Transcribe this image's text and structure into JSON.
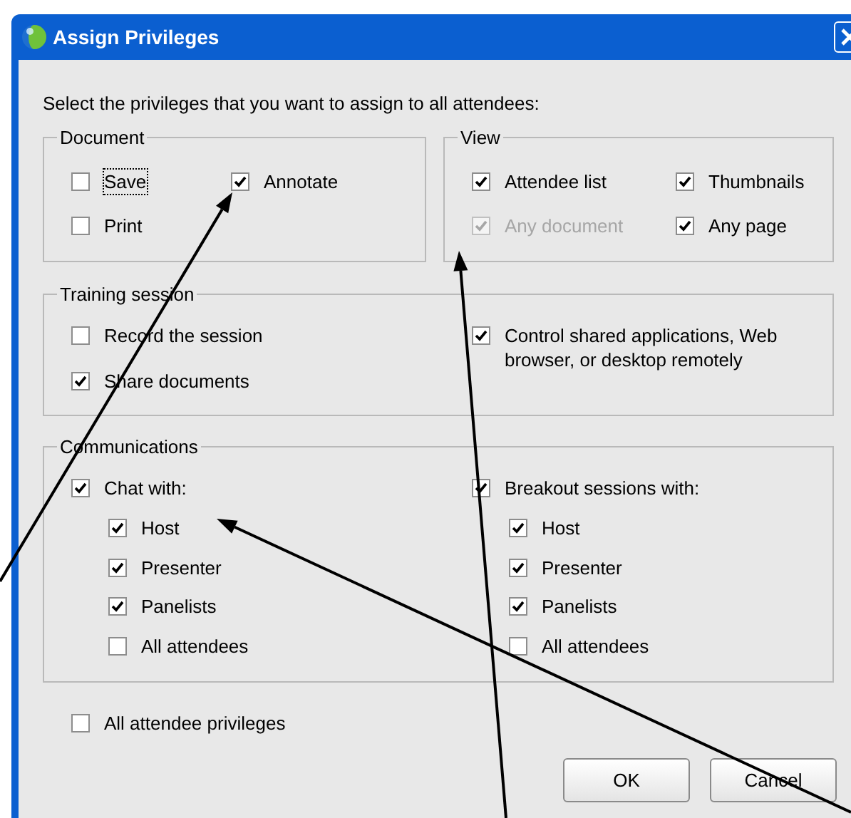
{
  "window": {
    "title": "Assign Privileges"
  },
  "instruction": "Select the privileges that you want to assign to all attendees:",
  "groups": [
    {
      "title": "Document",
      "items": [
        {
          "label": "Save",
          "checked": false,
          "disabled": false,
          "focused": true
        },
        {
          "label": "Annotate",
          "checked": true,
          "disabled": false,
          "focused": false
        },
        {
          "label": "Print",
          "checked": false,
          "disabled": false,
          "focused": false
        }
      ]
    },
    {
      "title": "View",
      "items": [
        {
          "label": "Attendee list",
          "checked": true,
          "disabled": false
        },
        {
          "label": "Thumbnails",
          "checked": true,
          "disabled": false
        },
        {
          "label": "Any document",
          "checked": true,
          "disabled": true
        },
        {
          "label": "Any page",
          "checked": true,
          "disabled": false
        }
      ]
    },
    {
      "title": "Training session",
      "items": [
        {
          "label": "Record the session",
          "checked": false,
          "disabled": false
        },
        {
          "label": "Control shared applications, Web browser, or desktop remotely",
          "checked": true,
          "disabled": false
        },
        {
          "label": "Share documents",
          "checked": true,
          "disabled": false
        }
      ]
    },
    {
      "title": "Communications",
      "items": [
        {
          "label": "Chat with:",
          "checked": true,
          "disabled": false,
          "children": [
            {
              "label": "Host",
              "checked": true
            },
            {
              "label": "Presenter",
              "checked": true
            },
            {
              "label": "Panelists",
              "checked": true
            },
            {
              "label": "All attendees",
              "checked": false
            }
          ]
        },
        {
          "label": "Breakout sessions with:",
          "checked": true,
          "disabled": false,
          "children": [
            {
              "label": "Host",
              "checked": true
            },
            {
              "label": "Presenter",
              "checked": true
            },
            {
              "label": "Panelists",
              "checked": true
            },
            {
              "label": "All attendees",
              "checked": false
            }
          ]
        }
      ]
    }
  ],
  "all_privileges": {
    "label": "All attendee privileges",
    "checked": false
  },
  "buttons": [
    "OK",
    "Cancel"
  ]
}
